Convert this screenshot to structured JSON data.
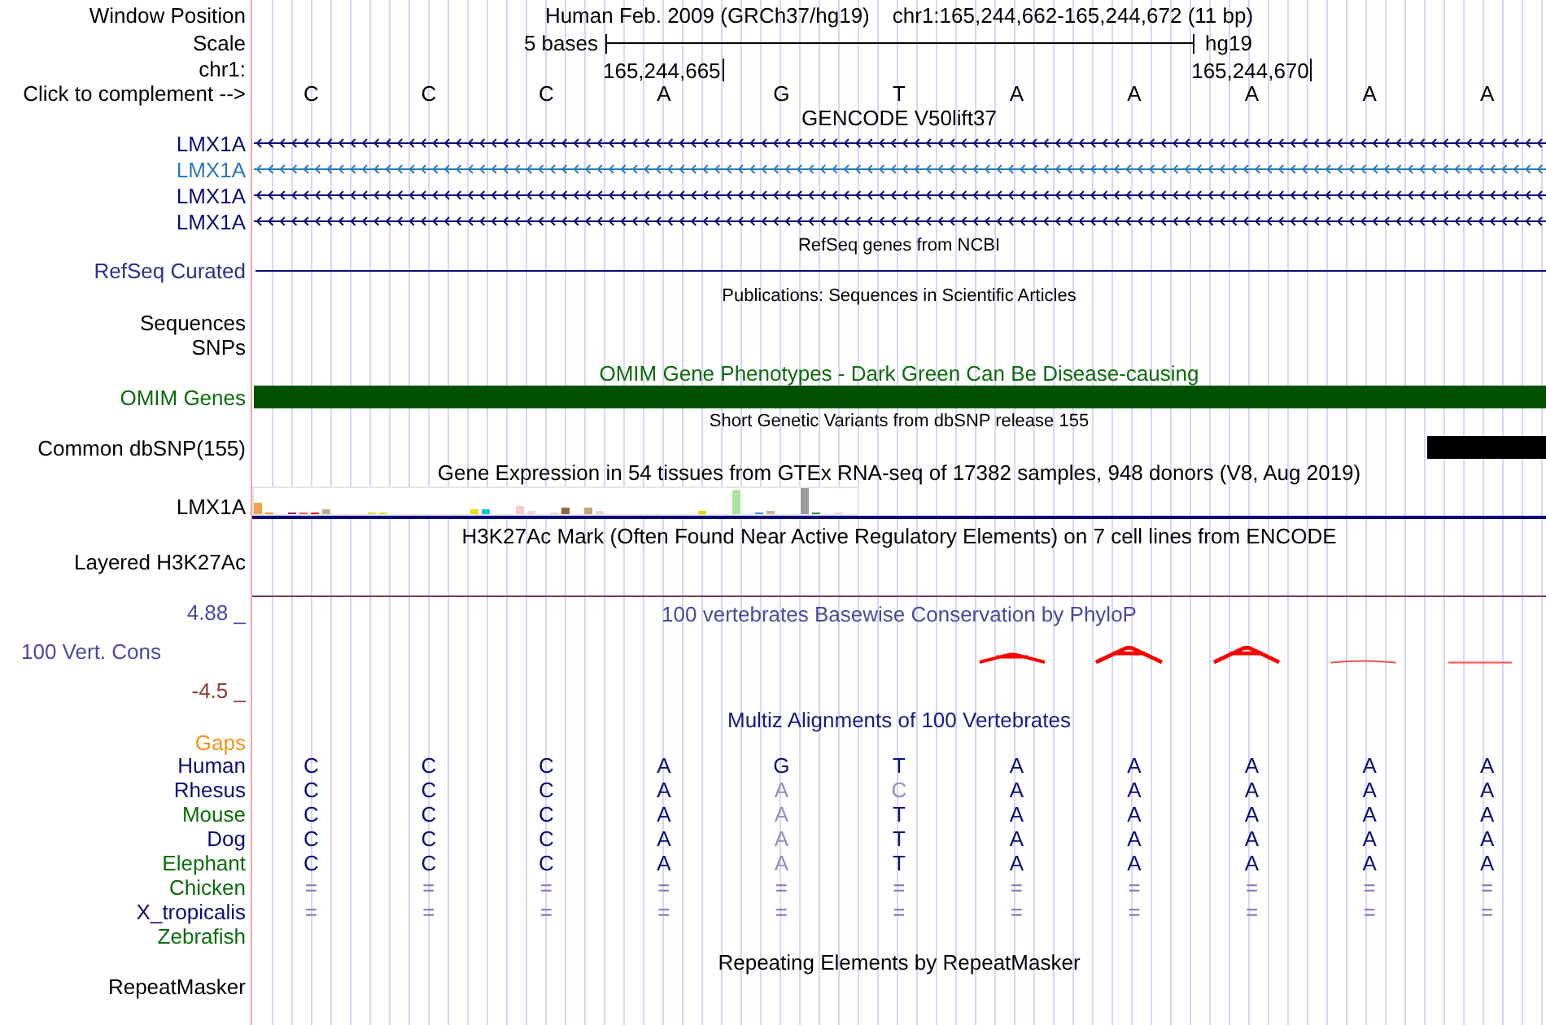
{
  "header": {
    "position_label": "Window Position",
    "assembly": "Human Feb. 2009 (GRCh37/hg19)",
    "position": "chr1:165,244,662-165,244,672 (11 bp)",
    "scale_label": "Scale",
    "scale_length": "5 bases",
    "scale_assembly": "hg19",
    "chromosome_label": "chr1:",
    "complement_label": "Click to complement -->"
  },
  "sequence": [
    {
      "base": "C"
    },
    {
      "base": "C"
    },
    {
      "base": "C"
    },
    {
      "base": "A",
      "coordinate": "165,244,665"
    },
    {
      "base": "G"
    },
    {
      "base": "T"
    },
    {
      "base": "A"
    },
    {
      "base": "A"
    },
    {
      "base": "A",
      "coordinate": "165,244,670"
    },
    {
      "base": "A"
    },
    {
      "base": "A"
    }
  ],
  "gencode": {
    "title": "GENCODE V50lift37",
    "transcripts": [
      {
        "name": "LMX1A",
        "color": "#0c0c78"
      },
      {
        "name": "LMX1A",
        "color": "#2a7ab8"
      },
      {
        "name": "LMX1A",
        "color": "#0c0c78"
      },
      {
        "name": "LMX1A",
        "color": "#0c0c78"
      }
    ]
  },
  "refseq": {
    "title": "RefSeq genes from NCBI",
    "label": "RefSeq Curated"
  },
  "publications": {
    "title": "Publications: Sequences in Scientific Articles",
    "labels": [
      "Sequences",
      "SNPs"
    ]
  },
  "omim": {
    "title": "OMIM Gene Phenotypes - Dark Green Can Be Disease-causing",
    "label": "OMIM Genes"
  },
  "dbsnp": {
    "title": "Short Genetic Variants from dbSNP release 155",
    "label": "Common dbSNP(155)"
  },
  "gtex": {
    "title": "Gene Expression in 54 tissues from GTEx RNA-seq of 17382 samples, 948 donors (V8, Aug 2019)",
    "label": "LMX1A"
  },
  "h3k27ac": {
    "title": "H3K27Ac Mark (Often Found Near Active Regulatory Elements) on 7 cell lines from ENCODE",
    "label": "Layered H3K27Ac"
  },
  "conservation": {
    "title": "100 vertebrates Basewise Conservation by PhyloP",
    "label": "100 Vert. Cons",
    "max_label": "4.88 _",
    "min_label": "-4.5 _"
  },
  "multiz": {
    "title": "Multiz Alignments of 100 Vertebrates",
    "gaps_label": "Gaps",
    "species": [
      {
        "name": "Human",
        "color": "#0c0c78",
        "kind": "aligned",
        "bases": [
          {
            "base": "C",
            "differs": false
          },
          {
            "base": "C",
            "differs": false
          },
          {
            "base": "C",
            "differs": false
          },
          {
            "base": "A",
            "differs": false
          },
          {
            "base": "G",
            "differs": false
          },
          {
            "base": "T",
            "differs": false
          },
          {
            "base": "A",
            "differs": false
          },
          {
            "base": "A",
            "differs": false
          },
          {
            "base": "A",
            "differs": false
          },
          {
            "base": "A",
            "differs": false
          },
          {
            "base": "A",
            "differs": false
          }
        ]
      },
      {
        "name": "Rhesus",
        "color": "#0c0c78",
        "kind": "aligned",
        "bases": [
          {
            "base": "C",
            "differs": false
          },
          {
            "base": "C",
            "differs": false
          },
          {
            "base": "C",
            "differs": false
          },
          {
            "base": "A",
            "differs": false
          },
          {
            "base": "A",
            "differs": true
          },
          {
            "base": "C",
            "differs": true
          },
          {
            "base": "A",
            "differs": false
          },
          {
            "base": "A",
            "differs": false
          },
          {
            "base": "A",
            "differs": false
          },
          {
            "base": "A",
            "differs": false
          },
          {
            "base": "A",
            "differs": false
          }
        ]
      },
      {
        "name": "Mouse",
        "color": "#0b6b0b",
        "kind": "aligned",
        "bases": [
          {
            "base": "C",
            "differs": false
          },
          {
            "base": "C",
            "differs": false
          },
          {
            "base": "C",
            "differs": false
          },
          {
            "base": "A",
            "differs": false
          },
          {
            "base": "A",
            "differs": true
          },
          {
            "base": "T",
            "differs": false
          },
          {
            "base": "A",
            "differs": false
          },
          {
            "base": "A",
            "differs": false
          },
          {
            "base": "A",
            "differs": false
          },
          {
            "base": "A",
            "differs": false
          },
          {
            "base": "A",
            "differs": false
          }
        ]
      },
      {
        "name": "Dog",
        "color": "#0c0c78",
        "kind": "aligned",
        "bases": [
          {
            "base": "C",
            "differs": false
          },
          {
            "base": "C",
            "differs": false
          },
          {
            "base": "C",
            "differs": false
          },
          {
            "base": "A",
            "differs": false
          },
          {
            "base": "A",
            "differs": true
          },
          {
            "base": "T",
            "differs": false
          },
          {
            "base": "A",
            "differs": false
          },
          {
            "base": "A",
            "differs": false
          },
          {
            "base": "A",
            "differs": false
          },
          {
            "base": "A",
            "differs": false
          },
          {
            "base": "A",
            "differs": false
          }
        ]
      },
      {
        "name": "Elephant",
        "color": "#0b6b0b",
        "kind": "aligned",
        "bases": [
          {
            "base": "C",
            "differs": false
          },
          {
            "base": "C",
            "differs": false
          },
          {
            "base": "C",
            "differs": false
          },
          {
            "base": "A",
            "differs": false
          },
          {
            "base": "A",
            "differs": true
          },
          {
            "base": "T",
            "differs": false
          },
          {
            "base": "A",
            "differs": false
          },
          {
            "base": "A",
            "differs": false
          },
          {
            "base": "A",
            "differs": false
          },
          {
            "base": "A",
            "differs": false
          },
          {
            "base": "A",
            "differs": false
          }
        ]
      },
      {
        "name": "Chicken",
        "color": "#0b6b0b",
        "kind": "unaligned",
        "bases": [
          {
            "base": "="
          },
          {
            "base": "="
          },
          {
            "base": "="
          },
          {
            "base": "="
          },
          {
            "base": "="
          },
          {
            "base": "="
          },
          {
            "base": "="
          },
          {
            "base": "="
          },
          {
            "base": "="
          },
          {
            "base": "="
          },
          {
            "base": "="
          }
        ]
      },
      {
        "name": "X_tropicalis",
        "color": "#0c0c78",
        "kind": "unaligned",
        "bases": [
          {
            "base": "="
          },
          {
            "base": "="
          },
          {
            "base": "="
          },
          {
            "base": "="
          },
          {
            "base": "="
          },
          {
            "base": "="
          },
          {
            "base": "="
          },
          {
            "base": "="
          },
          {
            "base": "="
          },
          {
            "base": "="
          },
          {
            "base": "="
          }
        ]
      },
      {
        "name": "Zebrafish",
        "color": "#0b6b0b",
        "kind": "missing"
      }
    ]
  },
  "repeatmasker": {
    "title": "Repeating Elements by RepeatMasker",
    "label": "RepeatMasker"
  }
}
